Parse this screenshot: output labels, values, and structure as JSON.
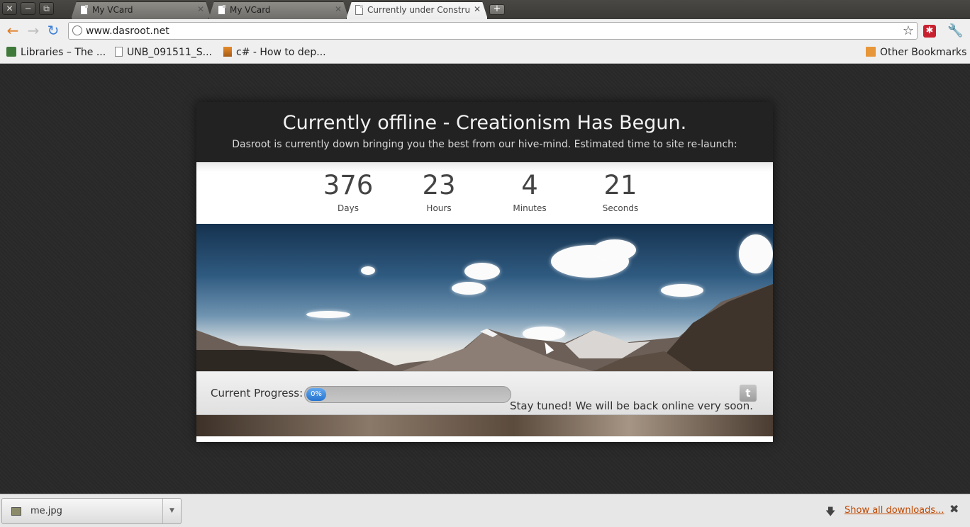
{
  "window": {
    "buttons": [
      "✕",
      "−",
      "⧉"
    ]
  },
  "tabs": [
    {
      "title": "My VCard",
      "close": "✕"
    },
    {
      "title": "My VCard",
      "close": "✕"
    },
    {
      "title": "Currently under Construct",
      "close": "✕"
    }
  ],
  "new_tab": "+",
  "toolbar": {
    "back": "←",
    "forward": "→",
    "reload": "↻",
    "url": "www.dasroot.net",
    "star": "☆",
    "extension": "✱",
    "wrench": "🔧"
  },
  "bookmarks": [
    {
      "label": "Libraries – The ...",
      "icon": "libraries-icon"
    },
    {
      "label": "UNB_091511_S...",
      "icon": "page-icon"
    },
    {
      "label": "c# - How to dep...",
      "icon": "stackoverflow-icon"
    }
  ],
  "other_bookmarks": "Other Bookmarks",
  "page": {
    "headline": "Currently offline - Creationism Has Begun.",
    "subline": "Dasroot is currently down bringing you the best from our hive-mind. Estimated time to site re-launch:",
    "countdown": [
      {
        "value": "376",
        "label": "Days"
      },
      {
        "value": "23",
        "label": "Hours"
      },
      {
        "value": "4",
        "label": "Minutes"
      },
      {
        "value": "21",
        "label": "Seconds"
      }
    ],
    "progress_label": "Current Progress:",
    "progress_value": 0,
    "progress_text": "0%",
    "twitter": "t",
    "stay_tuned": "Stay tuned! We will be back online very soon."
  },
  "downloads": {
    "file": "me.jpg",
    "menu": "▼",
    "show_all": "Show all downloads...",
    "arrow": "🡇",
    "close": "✖"
  }
}
